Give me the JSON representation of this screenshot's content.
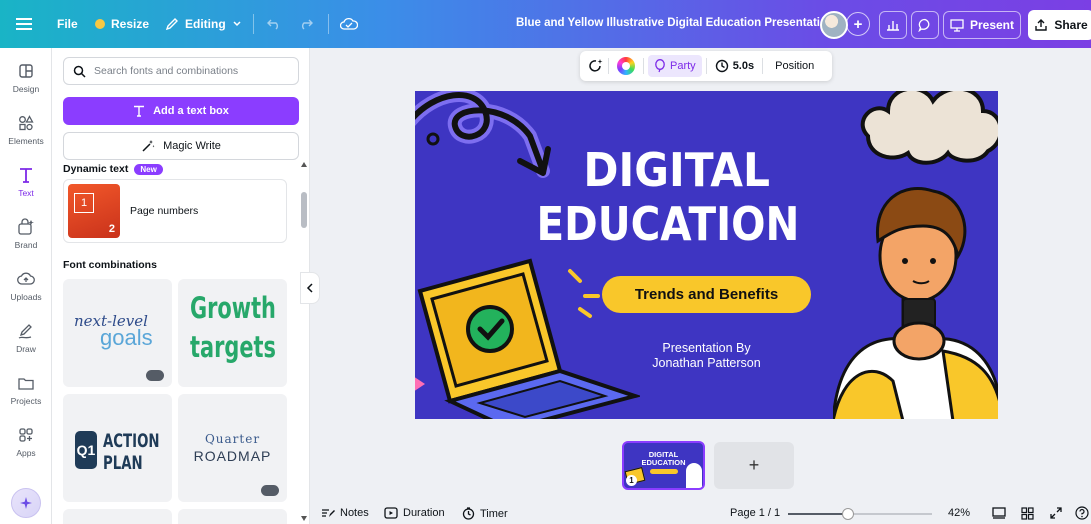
{
  "topbar": {
    "file": "File",
    "resize": "Resize",
    "editing": "Editing",
    "title": "Blue and Yellow Illustrative Digital Education Presentation",
    "present": "Present",
    "share": "Share"
  },
  "rail": {
    "items": [
      {
        "label": "Design",
        "icon": "layout-icon"
      },
      {
        "label": "Elements",
        "icon": "shapes-icon"
      },
      {
        "label": "Text",
        "icon": "text-icon"
      },
      {
        "label": "Brand",
        "icon": "brand-icon"
      },
      {
        "label": "Uploads",
        "icon": "cloud-upload-icon"
      },
      {
        "label": "Draw",
        "icon": "pen-icon"
      },
      {
        "label": "Projects",
        "icon": "folder-icon"
      },
      {
        "label": "Apps",
        "icon": "apps-icon"
      }
    ],
    "active": "Text"
  },
  "panel": {
    "search_placeholder": "Search fonts and combinations",
    "add_text": "Add a text box",
    "magic_write": "Magic Write",
    "dynamic_text": "Dynamic text",
    "new_badge": "New",
    "page_numbers": "Page numbers",
    "pn_thumb_1": "1",
    "pn_thumb_2": "2",
    "font_combinations": "Font combinations",
    "cards": {
      "c1_line1": "next-level",
      "c1_line2": "goals",
      "c2_line1": "Growth",
      "c2_line2": "targets",
      "c3_badge": "Q1",
      "c3_line1": "ACTION",
      "c3_line2": "PLAN",
      "c4_line1": "Quarter",
      "c4_line2": "ROADMAP"
    }
  },
  "context_bar": {
    "party": "Party",
    "duration": "5.0s",
    "position": "Position"
  },
  "slide": {
    "title_line1": "DIGITAL",
    "title_line2": "EDUCATION",
    "pill": "Trends and Benefits",
    "presenter_line1": "Presentation By",
    "presenter_line2": "Jonathan Patterson"
  },
  "thumbnail": {
    "line1": "DIGITAL",
    "line2": "EDUCATION",
    "page_badge": "1"
  },
  "add_page": "+",
  "bottom": {
    "notes": "Notes",
    "duration": "Duration",
    "timer": "Timer",
    "page": "Page 1 / 1",
    "zoom": "42%",
    "zoom_level": 0.42
  },
  "colors": {
    "accent": "#8b3dff",
    "slide_bg": "#3e35c2",
    "slide_yellow": "#f9c72a"
  }
}
